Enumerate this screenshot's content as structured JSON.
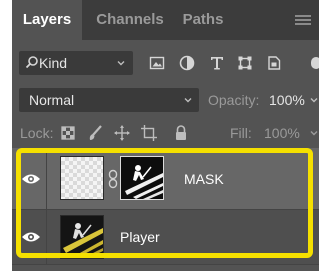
{
  "tabs": [
    {
      "label": "Layers"
    },
    {
      "label": "Channels"
    },
    {
      "label": "Paths"
    }
  ],
  "filter": {
    "kind_label": "Kind",
    "kind_icon": "search-icon",
    "filter_icons": [
      "image-filter-icon",
      "adjustment-filter-icon",
      "type-filter-icon",
      "shape-filter-icon",
      "smart-object-filter-icon"
    ]
  },
  "blend": {
    "mode": "Normal",
    "opacity_label": "Opacity:",
    "opacity_value": "100%"
  },
  "lock": {
    "label": "Lock:",
    "icons": [
      "lock-transparent-icon",
      "lock-image-icon",
      "lock-position-icon",
      "lock-artboard-icon",
      "lock-all-icon"
    ],
    "fill_label": "Fill:",
    "fill_value": "100%"
  },
  "layers": [
    {
      "name": "MASK",
      "visible": true,
      "has_mask": true,
      "linked": true
    },
    {
      "name": "Player",
      "visible": true,
      "has_mask": false
    }
  ],
  "colors": {
    "panel_bg": "#535353",
    "tabbar_bg": "#3c3c3c",
    "field_bg": "#3a3a3a",
    "selected_layer_bg": "#676767",
    "highlight": "#f5e000"
  }
}
